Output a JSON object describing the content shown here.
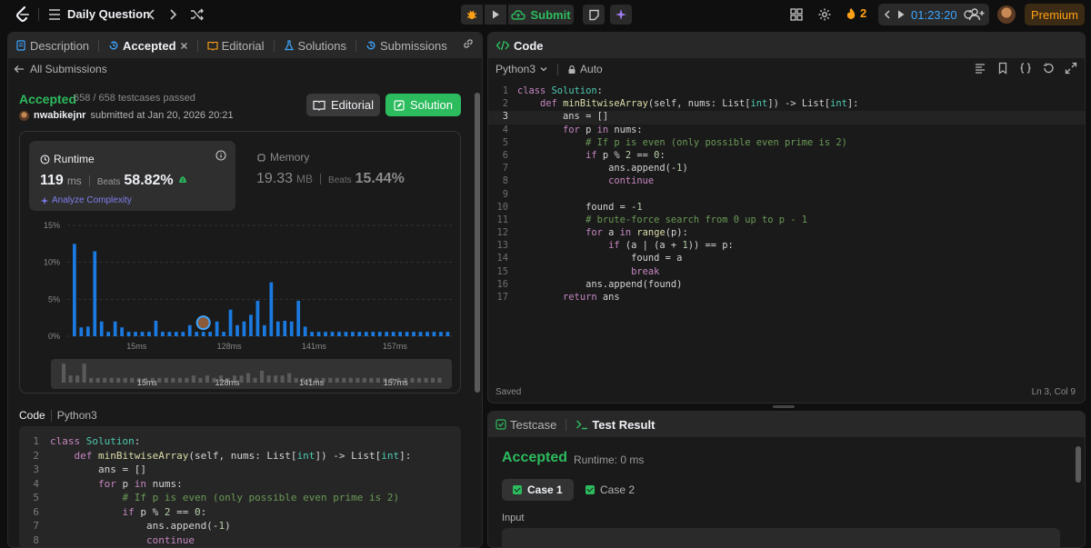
{
  "topbar": {
    "title": "Daily Question",
    "submit_label": "Submit",
    "streak": "2",
    "timer": "01:23:20",
    "premium": "Premium"
  },
  "left_panel": {
    "tabs": [
      {
        "label": "Description"
      },
      {
        "label": "Accepted"
      },
      {
        "label": "Editorial"
      },
      {
        "label": "Solutions"
      },
      {
        "label": "Submissions"
      }
    ],
    "back_label": "All Submissions",
    "status": "Accepted",
    "testcases": "658 / 658 testcases passed",
    "user": "nwabikejnr",
    "submitted": "submitted at Jan 20, 2026 20:21",
    "editorial_button": "Editorial",
    "solution_button": "Solution",
    "runtime": {
      "label": "Runtime",
      "value": "119",
      "unit": "ms",
      "beats_label": "Beats",
      "beats": "58.82%",
      "analyze": "Analyze Complexity"
    },
    "memory": {
      "label": "Memory",
      "value": "19.33",
      "unit": "MB",
      "beats_label": "Beats",
      "beats": "15.44%"
    },
    "code_label": "Code",
    "code_lang": "Python3",
    "code_lines": [
      "class Solution:",
      "    def minBitwiseArray(self, nums: List[int]) -> List[int]:",
      "        ans = []",
      "        for p in nums:",
      "            # If p is even (only possible even prime is 2)",
      "            if p % 2 == 0:",
      "                ans.append(-1)",
      "                continue"
    ]
  },
  "chart_data": {
    "type": "bar",
    "y_ticks": [
      "15%",
      "10%",
      "5%",
      "0%"
    ],
    "ylim": [
      0,
      15
    ],
    "x_ticks": [
      "15ms",
      "128ms",
      "141ms",
      "157ms"
    ],
    "values": [
      12.5,
      1.2,
      1.3,
      11.5,
      2.0,
      0.6,
      2.0,
      1.2,
      0.6,
      0.6,
      0.6,
      0.6,
      2.1,
      0.6,
      0.6,
      0.6,
      0.6,
      1.5,
      0.6,
      0.6,
      0.6,
      2.0,
      0.6,
      3.6,
      1.5,
      2.0,
      2.9,
      4.8,
      1.5,
      7.3,
      2.0,
      2.1,
      2.0,
      4.8,
      1.3,
      0.6,
      0.6,
      0.6,
      0.6,
      0.6,
      0.6,
      0.6,
      0.6,
      0.6,
      0.6,
      0.6,
      0.6,
      0.6,
      0.6,
      0.6,
      0.6,
      0.6,
      0.6,
      0.6,
      0.6,
      0.6
    ],
    "highlight_index": 19,
    "overview_values": [
      8,
      3,
      3,
      8,
      2,
      2,
      2,
      2,
      2,
      2,
      2,
      2,
      2,
      2,
      2,
      2,
      2,
      2,
      2,
      3,
      2,
      3,
      2,
      3,
      2,
      3,
      3,
      4,
      2,
      5,
      3,
      3,
      3,
      4,
      2,
      2,
      2,
      2,
      2,
      2,
      2,
      2,
      2,
      2,
      2,
      2,
      2,
      2,
      2,
      2,
      2,
      2,
      2,
      2,
      2,
      2
    ],
    "colors": {
      "bar": "#1a7ae0",
      "overview": "#5a5a5a"
    }
  },
  "editor": {
    "title": "Code",
    "lang": "Python3",
    "mode": "Auto",
    "saved": "Saved",
    "cursor": "Ln 3, Col 9",
    "lines": [
      "class Solution:",
      "    def minBitwiseArray(self, nums: List[int]) -> List[int]:",
      "        ans = []",
      "        for p in nums:",
      "            # If p is even (only possible even prime is 2)",
      "            if p % 2 == 0:",
      "                ans.append(-1)",
      "                continue",
      "",
      "            found = -1",
      "            # brute-force search from 0 up to p - 1",
      "            for a in range(p):",
      "                if (a | (a + 1)) == p:",
      "                    found = a",
      "                    break",
      "            ans.append(found)",
      "        return ans"
    ]
  },
  "result": {
    "tab_testcase": "Testcase",
    "tab_result": "Test Result",
    "status": "Accepted",
    "runtime": "Runtime: 0 ms",
    "case1": "Case 1",
    "case2": "Case 2",
    "input_label": "Input"
  }
}
